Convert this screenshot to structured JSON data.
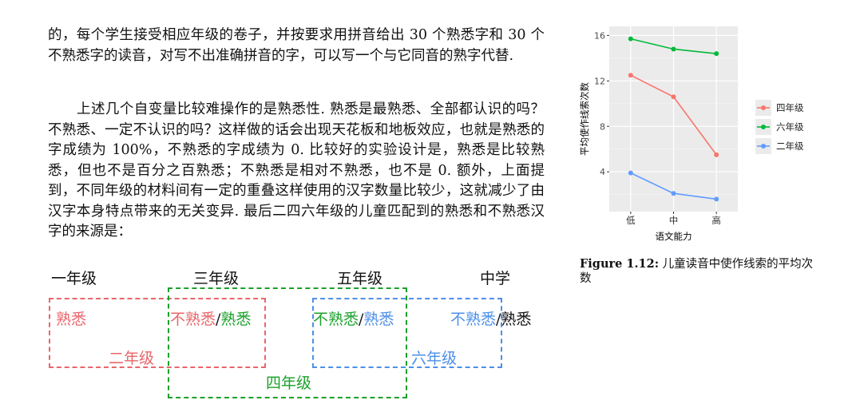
{
  "body_text": {
    "paragraph1": "的，每个学生接受相应年级的卷子，并按要求用拼音给出 30 个熟悉字和 30 个不熟悉字的读音，对写不出准确拼音的字，可以写一个与它同音的熟字代替.",
    "paragraph2": "上述几个自变量比较难操作的是熟悉性. 熟悉是最熟悉、全部都认识的吗？不熟悉、一定不认识的吗？这样做的话会出现天花板和地板效应，也就是熟悉的字成绩为 100%，不熟悉的字成绩为 0. 比较好的实验设计是，熟悉是比较熟悉，但也不是百分之百熟悉；不熟悉是相对不熟悉，也不是 0. 额外，上面提到，不同年级的材料间有一定的重叠这样使用的汉字数量比较少，这就减少了由汉字本身特点带来的无关变异. 最后二四六年级的儿童匹配到的熟悉和不熟悉汉字的来源是："
  },
  "diagram": {
    "grade_labels": [
      "一年级",
      "三年级",
      "五年级",
      "中学"
    ],
    "familiar": "熟悉",
    "unfamiliar": "不熟悉",
    "slash": "/",
    "group_labels": {
      "grade2": "二年级",
      "grade4": "四年级",
      "grade6": "六年级"
    },
    "colors": {
      "grade2": "#e9666a",
      "grade4": "#1aa12a",
      "grade6": "#4d8fe8"
    }
  },
  "chart_data": {
    "type": "line",
    "categories": [
      "低",
      "中",
      "高"
    ],
    "series": [
      {
        "name": "四年级",
        "values": [
          12.5,
          10.6,
          5.5
        ],
        "color": "#f8766d"
      },
      {
        "name": "六年级",
        "values": [
          15.7,
          14.8,
          14.4
        ],
        "color": "#00ba38"
      },
      {
        "name": "二年级",
        "values": [
          3.9,
          2.1,
          1.6
        ],
        "color": "#619cff"
      }
    ],
    "xlabel": "语文能力",
    "ylabel": "平均使作线索次数",
    "ylim": [
      0.5,
      16.8
    ],
    "yticks": [
      4,
      8,
      12,
      16
    ],
    "grid": true,
    "legend": "right"
  },
  "caption": {
    "label": "Figure 1.12:",
    "text": " 儿童读音中使作线索的平均次数"
  }
}
